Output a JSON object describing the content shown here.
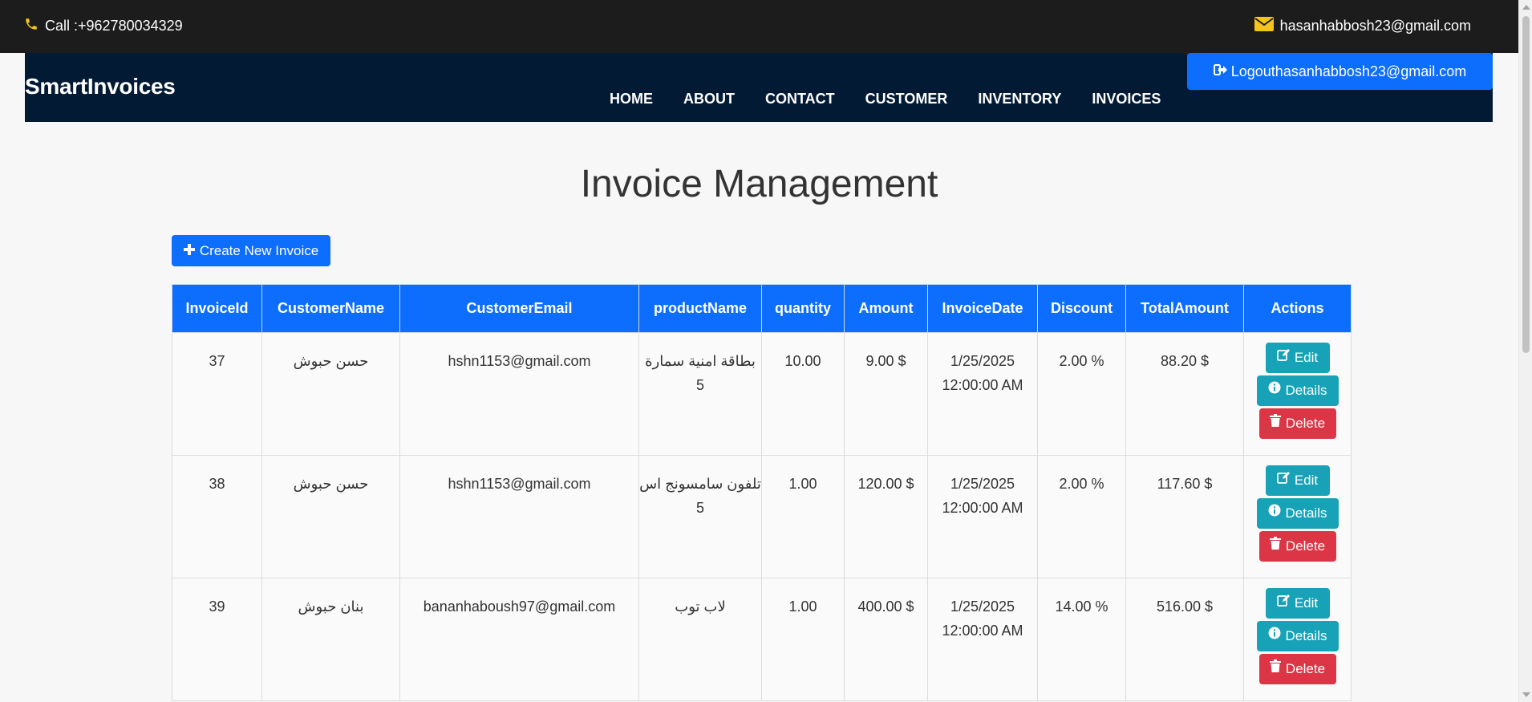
{
  "topbar": {
    "phone_icon": "phone-icon",
    "phone_text": "Call :+962780034329",
    "mail_icon": "envelope-icon",
    "email_text": "hasanhabbosh23@gmail.com",
    "icon_color": "#f5c518"
  },
  "navbar": {
    "brand": "SmartInvoices",
    "links": [
      "HOME",
      "ABOUT",
      "CONTACT",
      "CUSTOMER",
      "INVENTORY",
      "INVOICES"
    ],
    "logout_label": "Logouthasanhabbosh23@gmail.com",
    "bg_color": "#031a35"
  },
  "page": {
    "title": "Invoice Management",
    "create_label": "Create New Invoice"
  },
  "table": {
    "headers": [
      "InvoiceId",
      "CustomerName",
      "CustomerEmail",
      "productName",
      "quantity",
      "Amount",
      "InvoiceDate",
      "Discount",
      "TotalAmount",
      "Actions"
    ],
    "rows": [
      {
        "id": "37",
        "name": "حسن حبوش",
        "email": "hshn1153@gmail.com",
        "product": "بطاقة امنية سمارة 5",
        "quantity": "10.00",
        "amount": "9.00 $",
        "date": "1/25/2025 12:00:00 AM",
        "discount": "2.00 %",
        "total": "88.20 $"
      },
      {
        "id": "38",
        "name": "حسن حبوش",
        "email": "hshn1153@gmail.com",
        "product": "تلفون سامسونج اس 5",
        "quantity": "1.00",
        "amount": "120.00 $",
        "date": "1/25/2025 12:00:00 AM",
        "discount": "2.00 %",
        "total": "117.60 $"
      },
      {
        "id": "39",
        "name": "بنان حبوش",
        "email": "bananhaboush97@gmail.com",
        "product": "لاب توب",
        "quantity": "1.00",
        "amount": "400.00 $",
        "date": "1/25/2025 12:00:00 AM",
        "discount": "14.00 %",
        "total": "516.00 $"
      }
    ],
    "actions": {
      "edit": "Edit",
      "details": "Details",
      "delete": "Delete"
    }
  }
}
